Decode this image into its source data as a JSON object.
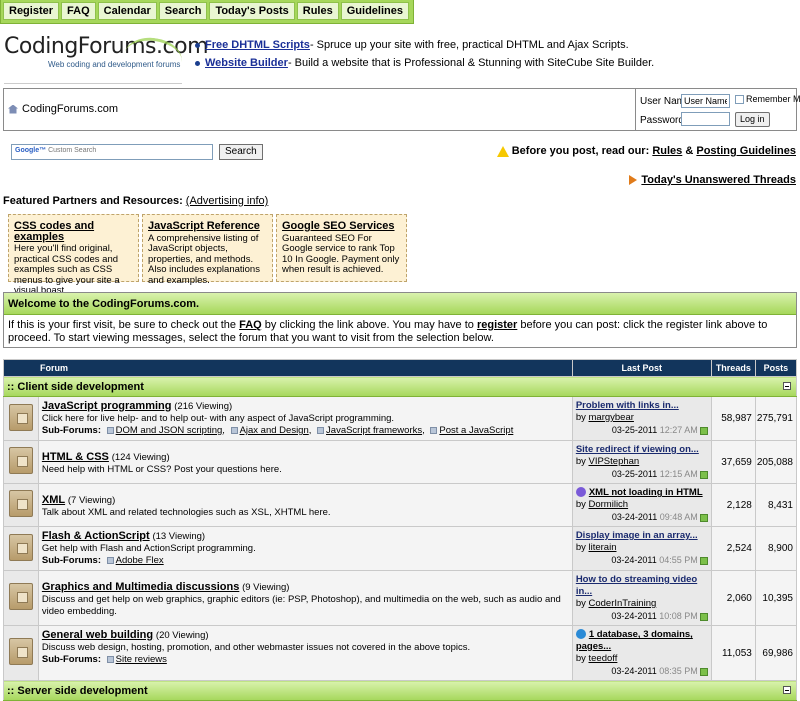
{
  "topnav": [
    "Register",
    "FAQ",
    "Calendar",
    "Search",
    "Today's Posts",
    "Rules",
    "Guidelines"
  ],
  "logo": {
    "brand": "CodingForums.com",
    "tagline": "Web coding and development forums"
  },
  "promos": [
    {
      "link": "Free DHTML Scripts",
      "text": "- Spruce up your site with free, practical DHTML and Ajax Scripts."
    },
    {
      "link": "Website Builder",
      "text": "- Build a website that is Professional & Stunning with SiteCube Site Builder."
    }
  ],
  "breadcrumb": "CodingForums.com",
  "login": {
    "username_label": "User Name",
    "username_value": "User Name",
    "password_label": "Password",
    "remember_label": "Remember Me?",
    "button": "Log in"
  },
  "search": {
    "placeholder_brand": "Google™",
    "placeholder": "Custom Search",
    "button": "Search"
  },
  "notice": {
    "prefix": "Before you post, read our:",
    "rules": "Rules",
    "amp": "&",
    "guidelines": "Posting Guidelines"
  },
  "unanswered": "Today's Unanswered Threads",
  "featured": {
    "label": "Featured Partners and Resources:",
    "ad": "(Advertising info)"
  },
  "partners": [
    {
      "title": "CSS codes and examples",
      "text": "Here you'll find original, practical CSS codes and examples such as CSS menus to give your site a visual boast."
    },
    {
      "title": "JavaScript Reference",
      "text": "A comprehensive listing of JavaScript objects, properties, and methods. Also includes explanations and examples."
    },
    {
      "title": "Google SEO Services",
      "text": "Guaranteed SEO For Google service to rank Top 10 In Google. Payment only when result is achieved."
    }
  ],
  "welcome": {
    "title": "Welcome to the CodingForums.com.",
    "p1": "If this is your first visit, be sure to check out the ",
    "faq": "FAQ",
    "p2": " by clicking the link above. You may have to ",
    "register": "register",
    "p3": " before you can post: click the register link above to proceed. To start viewing messages, select the forum that you want to visit from the selection below."
  },
  "table_headers": {
    "forum": "Forum",
    "last_post": "Last Post",
    "threads": "Threads",
    "posts": "Posts"
  },
  "categories": [
    ":: Client side development",
    ":: Server side development"
  ],
  "forums": [
    {
      "title": "JavaScript programming",
      "viewing": "(216 Viewing)",
      "desc": "Click here for live help- and to help out- with any aspect of JavaScript programming.",
      "subforums_label": "Sub-Forums:",
      "subforums": [
        "DOM and JSON scripting",
        "Ajax and Design",
        "JavaScript frameworks",
        "Post a JavaScript"
      ],
      "last_title": "Problem with links in...",
      "by": "by",
      "user": "margybear",
      "date": "03-25-2011",
      "time": "12:27 AM",
      "threads": "58,987",
      "posts": "275,791"
    },
    {
      "title": "HTML & CSS",
      "viewing": "(124 Viewing)",
      "desc": "Need help with HTML or CSS? Post your questions here.",
      "subforums_label": "",
      "subforums": [],
      "last_title": "Site redirect if viewing on...",
      "by": "by",
      "user": "VIPStephan",
      "date": "03-25-2011",
      "time": "12:15 AM",
      "threads": "37,659",
      "posts": "205,088"
    },
    {
      "title": "XML",
      "viewing": "(7 Viewing)",
      "desc": "Talk about XML and related technologies such as XSL, XHTML here.",
      "subforums_label": "",
      "subforums": [],
      "last_title": "XML not loading in HTML",
      "by": "by",
      "user": "Dormilich",
      "date": "03-24-2011",
      "time": "09:48 AM",
      "threads": "2,128",
      "posts": "8,431"
    },
    {
      "title": "Flash & ActionScript",
      "viewing": "(13 Viewing)",
      "desc": "Get help with Flash and ActionScript programming.",
      "subforums_label": "Sub-Forums:",
      "subforums": [
        "Adobe Flex"
      ],
      "last_title": "Display image in an array...",
      "by": "by",
      "user": "literain",
      "date": "03-24-2011",
      "time": "04:55 PM",
      "threads": "2,524",
      "posts": "8,900"
    },
    {
      "title": "Graphics and Multimedia discussions",
      "viewing": "(9 Viewing)",
      "desc": "Discuss and get help on web graphics, graphic editors (ie: PSP, Photoshop), and multimedia on the web, such as audio and video embedding.",
      "subforums_label": "",
      "subforums": [],
      "last_title": "How to do streaming video in...",
      "by": "by",
      "user": "CoderInTraining",
      "date": "03-24-2011",
      "time": "10:08 PM",
      "threads": "2,060",
      "posts": "10,395"
    },
    {
      "title": "General web building",
      "viewing": "(20 Viewing)",
      "desc": "Discuss web design, hosting, promotion, and other webmaster issues not covered in the above topics.",
      "subforums_label": "Sub-Forums:",
      "subforums": [
        "Site reviews"
      ],
      "last_title": "1 database, 3 domains, pages...",
      "by": "by",
      "user": "teedoff",
      "date": "03-24-2011",
      "time": "08:35 PM",
      "threads": "11,053",
      "posts": "69,986"
    }
  ],
  "colors": {
    "nav_green": "#a6d75b",
    "header_navy": "#12355c",
    "partner_bg": "#fdf1d4"
  }
}
